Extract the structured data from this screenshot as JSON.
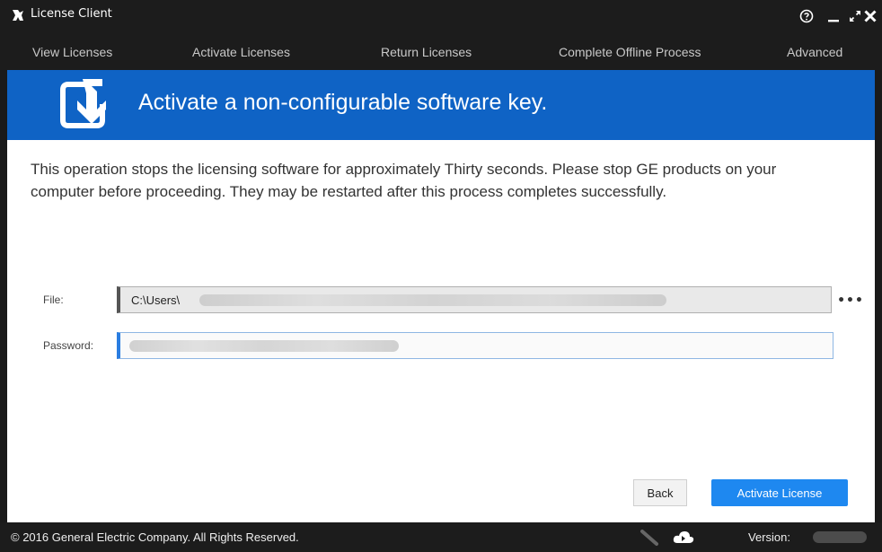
{
  "window": {
    "title": "License Client"
  },
  "nav": {
    "items": [
      {
        "label": "View Licenses"
      },
      {
        "label": "Activate Licenses"
      },
      {
        "label": "Return Licenses"
      },
      {
        "label": "Complete Offline Process"
      },
      {
        "label": "Advanced"
      }
    ]
  },
  "banner": {
    "title": "Activate a non-configurable software key.",
    "icon": "activate-arrow-icon",
    "color": "#0f63c5"
  },
  "content": {
    "description": "This operation stops the licensing software for approximately Thirty seconds. Please stop GE products on your computer before proceeding. They may be restarted after this process completes successfully."
  },
  "form": {
    "file_label": "File:",
    "file_value": "C:\\Users\\",
    "browse_label": "•••",
    "password_label": "Password:"
  },
  "buttons": {
    "back": "Back",
    "activate": "Activate License",
    "accent": "#1e88f0"
  },
  "footer": {
    "copyright": "© 2016 General Electric Company. All Rights Reserved.",
    "version_label": "Version:"
  }
}
